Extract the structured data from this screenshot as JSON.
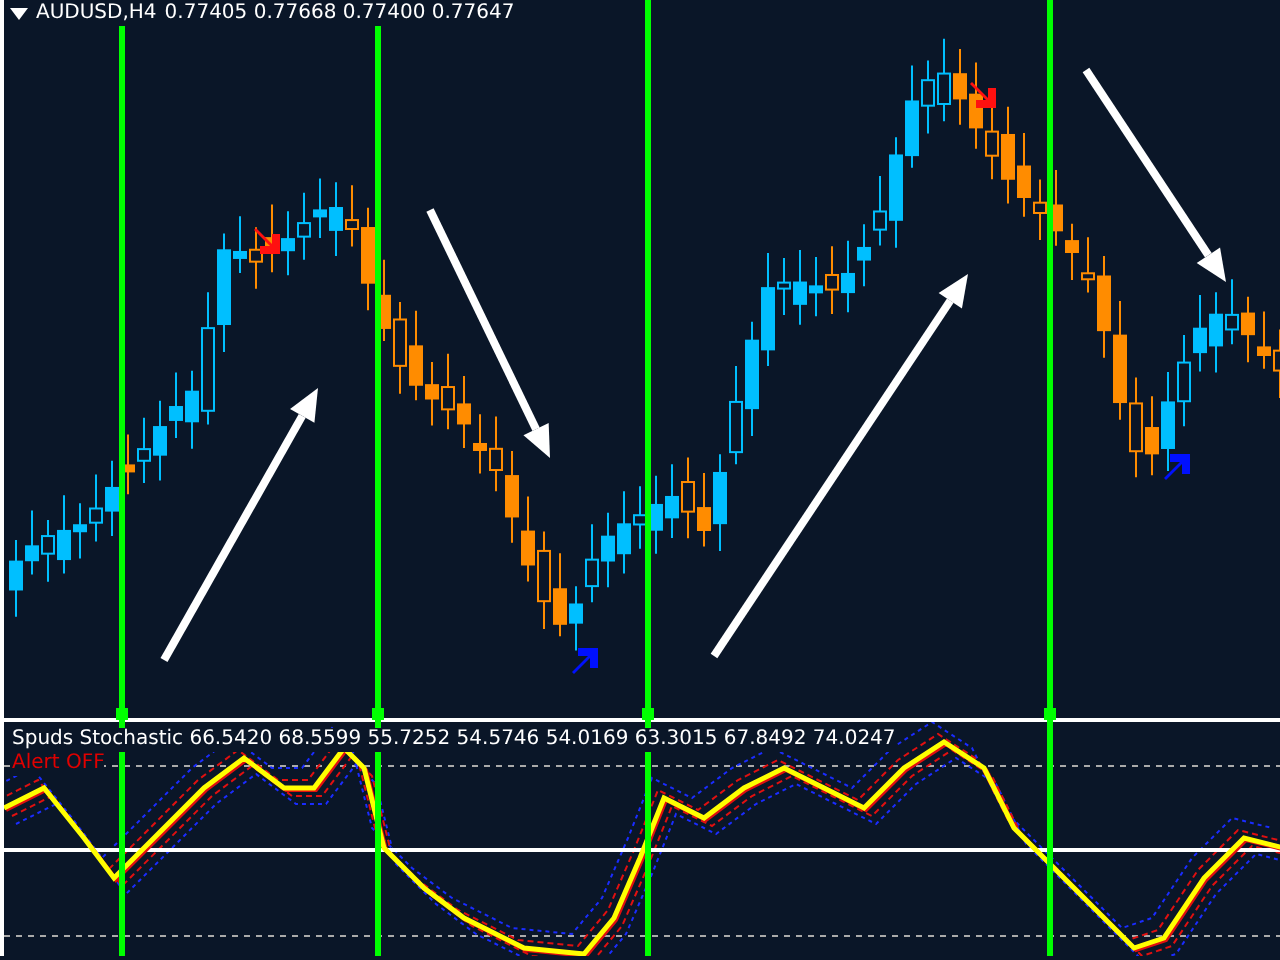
{
  "price_panel": {
    "symbol": "AUDUSD,H4",
    "quote": "0.77405 0.77668 0.77400 0.77647"
  },
  "indicator_panel": {
    "title": "Spuds Stochastic 66.5420 68.5599 55.7252 54.5746 54.0169 63.3015 67.8492 74.0247",
    "alert": "Alert OFF"
  }
}
